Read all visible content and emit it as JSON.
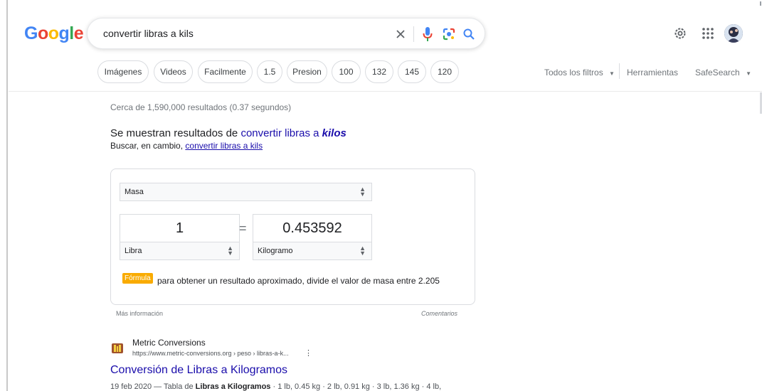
{
  "search": {
    "query": "convertir libras a kils"
  },
  "logo": {
    "letters": [
      "G",
      "o",
      "o",
      "g",
      "l",
      "e"
    ],
    "colors": [
      "#4285f4",
      "#ea4335",
      "#fbbc05",
      "#4285f4",
      "#34a853",
      "#ea4335"
    ]
  },
  "header": {
    "icons": [
      "clear-icon",
      "microphone-icon",
      "lens-icon",
      "search-icon",
      "gear-icon",
      "apps-icon",
      "avatar"
    ]
  },
  "chips": [
    "Imágenes",
    "Videos",
    "Facilmente",
    "1.5",
    "Presion",
    "100",
    "132",
    "145",
    "120"
  ],
  "tools": {
    "all_filters": "Todos los filtros",
    "tools": "Herramientas",
    "safesearch": "SafeSearch"
  },
  "stats": "Cerca de 1,590,000 resultados (0.37 segundos)",
  "spelling": {
    "prefix": "Se muestran resultados de ",
    "corrected_plain": "convertir libras a ",
    "corrected_bold": "kilos",
    "instead_prefix": "Buscar, en cambio, ",
    "instead_link": "convertir libras a kils"
  },
  "converter": {
    "quantity": "Masa",
    "from_value": "1",
    "equals": "=",
    "to_value": "0.453592",
    "from_unit": "Libra",
    "to_unit": "Kilogramo",
    "formula_label": "Fórmula",
    "formula_text": "para obtener un resultado aproximado, divide el valor de masa entre 2.205",
    "more_info": "Más información",
    "feedback": "Comentarios"
  },
  "result": {
    "site_name": "Metric Conversions",
    "url": "https://www.metric-conversions.org › peso › libras-a-k...",
    "menu": "⋮",
    "title": "Conversión de Libras a Kilogramos",
    "snippet_prefix": "19 feb 2020 — Tabla de ",
    "snippet_bold": "Libras a Kilogramos",
    "snippet_suffix": " · 1 lb, 0.45 kg · 2 lb, 0.91 kg · 3 lb, 1.36 kg · 4 lb,"
  }
}
